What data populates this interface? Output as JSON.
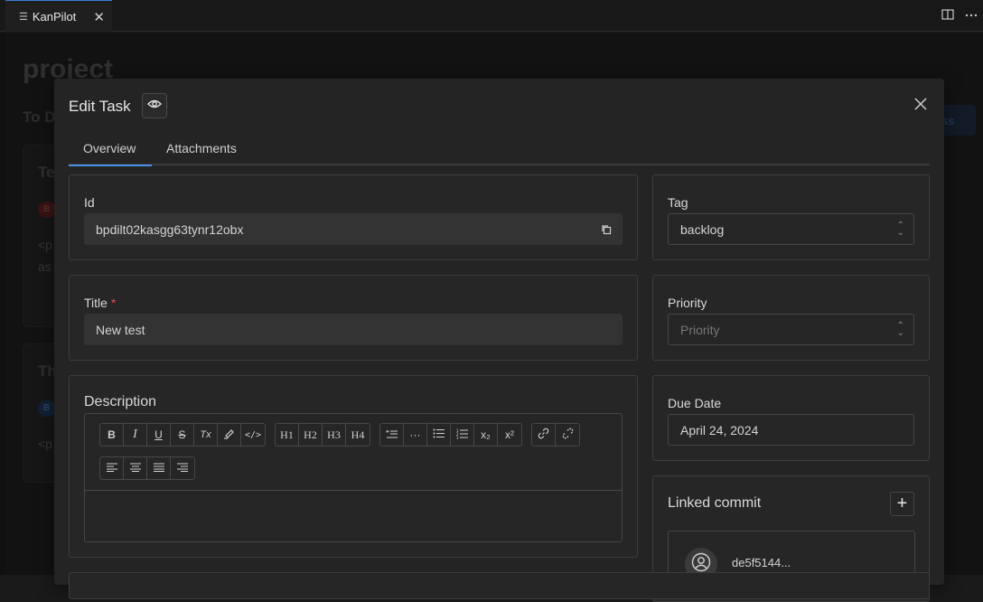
{
  "editor": {
    "tab_label": "KanPilot",
    "tab_close": "✕"
  },
  "background": {
    "project_title": "project",
    "column_title": "To D",
    "button_fragment": "ss",
    "card1_title": "Te",
    "card1_badge": "B",
    "card1_text1": "<p",
    "card1_text2": "as",
    "card2_title": "Th",
    "card2_badge": "B",
    "card2_text": "<p"
  },
  "modal": {
    "title": "Edit Task",
    "tabs": [
      {
        "label": "Overview",
        "active": true
      },
      {
        "label": "Attachments",
        "active": false
      }
    ],
    "id": {
      "label": "Id",
      "value": "bpdilt02kasgg63tynr12obx"
    },
    "title_field": {
      "label": "Title",
      "required_mark": "*",
      "value": "New test"
    },
    "description": {
      "label": "Description"
    },
    "tag": {
      "label": "Tag",
      "value": "backlog"
    },
    "priority": {
      "label": "Priority",
      "placeholder": "Priority"
    },
    "due_date": {
      "label": "Due Date",
      "value": "April 24, 2024"
    },
    "linked_commit": {
      "label": "Linked commit",
      "add_label": "+",
      "hash": "de5f5144..."
    }
  },
  "toolbar": {
    "format": [
      "B",
      "I",
      "U",
      "S",
      "Tx",
      "hl",
      "</>"
    ],
    "headings": [
      "H1",
      "H2",
      "H3",
      "H4"
    ],
    "blocks": [
      "quote",
      "···",
      "ul",
      "ol",
      "x₂",
      "x²"
    ],
    "links": [
      "link",
      "unlink"
    ],
    "align": [
      "left",
      "center",
      "justify",
      "right"
    ]
  },
  "colors": {
    "accent": "#4a90e2",
    "required": "#e5484d",
    "modal_bg": "#242424"
  }
}
